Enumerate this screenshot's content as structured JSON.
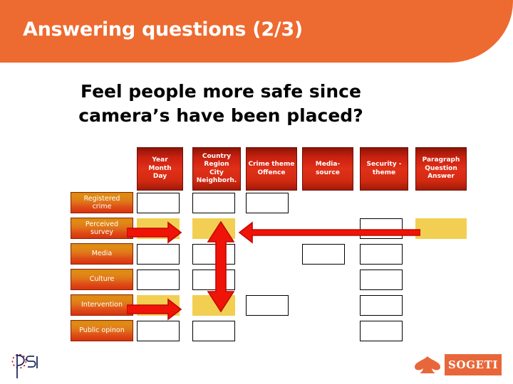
{
  "header": {
    "title": "Answering questions (2/3)",
    "banner_color": "#ed6a30"
  },
  "subtitle": {
    "line1": "Feel people more safe since",
    "line2": "camera’s have been placed?"
  },
  "matrix": {
    "column_headers": [
      {
        "id": "time",
        "text": "Year\nMonth\nDay"
      },
      {
        "id": "place",
        "text": "Country\nRegion\nCity\nNeighborh."
      },
      {
        "id": "crime",
        "text": "Crime theme\nOffence"
      },
      {
        "id": "media",
        "text": "Media-\nsource"
      },
      {
        "id": "security",
        "text": "Security -\ntheme"
      },
      {
        "id": "paragraph",
        "text": "Paragraph\nQuestion\nAnswer"
      }
    ],
    "row_headers": [
      {
        "id": "registered-crime",
        "text": "Registered\ncrime"
      },
      {
        "id": "perceived-survey",
        "text": "Perceived\nsurvey"
      },
      {
        "id": "media",
        "text": "Media"
      },
      {
        "id": "culture",
        "text": "Culture"
      },
      {
        "id": "intervention",
        "text": "Intervention"
      },
      {
        "id": "public-opinon",
        "text": "Public opinon"
      }
    ],
    "cells": [
      {
        "row": "registered-crime",
        "col": "time",
        "state": "empty"
      },
      {
        "row": "registered-crime",
        "col": "place",
        "state": "empty"
      },
      {
        "row": "registered-crime",
        "col": "crime",
        "state": "empty"
      },
      {
        "row": "perceived-survey",
        "col": "time",
        "state": "filled"
      },
      {
        "row": "perceived-survey",
        "col": "place",
        "state": "filled"
      },
      {
        "row": "perceived-survey",
        "col": "security",
        "state": "empty"
      },
      {
        "row": "perceived-survey",
        "col": "paragraph",
        "state": "filled"
      },
      {
        "row": "media",
        "col": "time",
        "state": "empty"
      },
      {
        "row": "media",
        "col": "place",
        "state": "empty"
      },
      {
        "row": "media",
        "col": "media",
        "state": "empty"
      },
      {
        "row": "media",
        "col": "security",
        "state": "empty"
      },
      {
        "row": "culture",
        "col": "time",
        "state": "empty"
      },
      {
        "row": "culture",
        "col": "place",
        "state": "empty"
      },
      {
        "row": "culture",
        "col": "security",
        "state": "empty"
      },
      {
        "row": "intervention",
        "col": "time",
        "state": "filled"
      },
      {
        "row": "intervention",
        "col": "place",
        "state": "filled"
      },
      {
        "row": "intervention",
        "col": "crime",
        "state": "empty"
      },
      {
        "row": "intervention",
        "col": "security",
        "state": "empty"
      },
      {
        "row": "public-opinon",
        "col": "time",
        "state": "empty"
      },
      {
        "row": "public-opinon",
        "col": "place",
        "state": "empty"
      },
      {
        "row": "public-opinon",
        "col": "security",
        "state": "empty"
      }
    ],
    "arrows": [
      {
        "id": "arrow-perceived-right",
        "direction": "right",
        "color": "#f01408"
      },
      {
        "id": "arrow-paragraph-left",
        "direction": "left",
        "color": "#f01408"
      },
      {
        "id": "arrow-vertical-up",
        "direction": "up",
        "color": "#f01408"
      },
      {
        "id": "arrow-vertical-down",
        "direction": "down",
        "color": "#f01408"
      },
      {
        "id": "arrow-intervention-right",
        "direction": "right",
        "color": "#f01408"
      }
    ]
  },
  "footer": {
    "left_logo": "ps-logo",
    "right_logo": "sogeti-logo",
    "sogeti_word": "SOGETI",
    "sogeti_color": "#e8673a"
  }
}
